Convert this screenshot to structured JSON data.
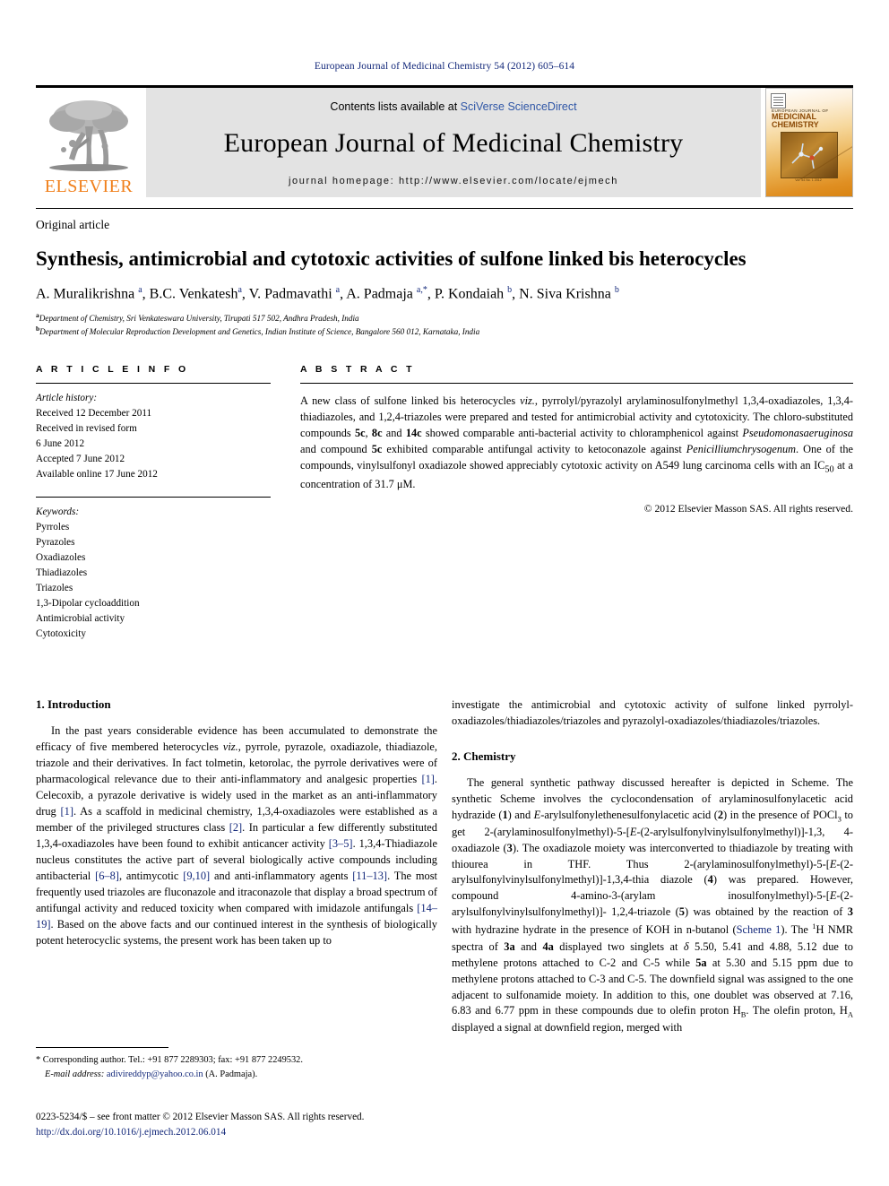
{
  "running_head": "European Journal of Medicinal Chemistry 54 (2012) 605–614",
  "masthead": {
    "contents_prefix": "Contents lists available at ",
    "contents_link": "SciVerse ScienceDirect",
    "journal_title": "European Journal of Medicinal Chemistry",
    "homepage": "journal homepage: http://www.elsevier.com/locate/ejmech",
    "publisher_logo_text": "ELSEVIER",
    "cover": {
      "line1": "EUROPEAN JOURNAL OF",
      "line2": "MEDICINAL CHEMISTRY",
      "caption": "Vol. 54  No. 1  2012"
    }
  },
  "article": {
    "type": "Original article",
    "title": "Synthesis, antimicrobial and cytotoxic activities of sulfone linked bis heterocycles",
    "authors_html": "A. Muralikrishna <sup>a</sup>, B.C. Venkatesh<sup>a</sup>, V. Padmavathi <sup>a</sup>, A. Padmaja <sup>a,*</sup>, P. Kondaiah <sup>b</sup>, N. Siva Krishna <sup>b</sup>",
    "affiliation_a": "Department of Chemistry, Sri Venkateswara University, Tirupati 517 502, Andhra Pradesh, India",
    "affiliation_b": "Department of Molecular Reproduction Development and Genetics, Indian Institute of Science, Bangalore 560 012, Karnataka, India"
  },
  "article_info": {
    "heading": "A R T I C L E   I N F O",
    "history_title": "Article history:",
    "history": [
      "Received 12 December 2011",
      "Received in revised form",
      "6 June 2012",
      "Accepted 7 June 2012",
      "Available online 17 June 2012"
    ],
    "keywords_title": "Keywords:",
    "keywords": [
      "Pyrroles",
      "Pyrazoles",
      "Oxadiazoles",
      "Thiadiazoles",
      "Triazoles",
      "1,3-Dipolar cycloaddition",
      "Antimicrobial activity",
      "Cytotoxicity"
    ]
  },
  "abstract": {
    "heading": "A B S T R A C T",
    "text_html": "A new class of sulfone linked bis heterocycles <i>viz.</i>, pyrrolyl/pyrazolyl arylaminosulfonylmethyl 1,3,4-oxadiazoles, 1,3,4-thiadiazoles, and 1,2,4-triazoles were prepared and tested for antimicrobial activity and cytotoxicity. The chloro-substituted compounds <b>5c</b>, <b>8c</b> and <b>14c</b> showed comparable anti-bacterial activity to chloramphenicol against <i>Pseudomonasaeruginosa</i> and compound <b>5c</b> exhibited comparable antifungal activity to ketoconazole against <i>Penicilliumchrysogenum</i>. One of the compounds, vinylsulfonyl oxadiazole showed appreciably cytotoxic activity on A549 lung carcinoma cells with an IC<sub>50</sub> at a concentration of 31.7 μM.",
    "copyright": "© 2012 Elsevier Masson SAS. All rights reserved."
  },
  "sections": {
    "introduction": {
      "number_title": "1.  Introduction",
      "para_left_html": "In the past years considerable evidence has been accumulated to demonstrate the efficacy of five membered heterocycles <i>viz.</i>, pyrrole, pyrazole, oxadiazole, thiadiazole, triazole and their derivatives. In fact tolmetin, ketorolac, the pyrrole derivatives were of pharmacological relevance due to their anti-inflammatory and analgesic properties <span class=\"ref\">[1]</span>. Celecoxib, a pyrazole derivative is widely used in the market as an anti-inflammatory drug <span class=\"ref\">[1]</span>. As a scaffold in medicinal chemistry, 1,3,4-oxadiazoles were established as a member of the privileged structures class <span class=\"ref\">[2]</span>. In particular a few differently substituted 1,3,4-oxadiazoles have been found to exhibit anticancer activity <span class=\"ref\">[3–5]</span>. 1,3,4-Thiadiazole nucleus constitutes the active part of several biologically active compounds including antibacterial <span class=\"ref\">[6–8]</span>, antimycotic <span class=\"ref\">[9,10]</span> and anti-inflammatory agents <span class=\"ref\">[11–13]</span>. The most frequently used triazoles are fluconazole and itraconazole that display a broad spectrum of antifungal activity and reduced toxicity when compared with imidazole antifungals <span class=\"ref\">[14–19]</span>. Based on the above facts and our continued interest in the synthesis of biologically potent heterocyclic systems, the present work has been taken up to",
      "para_right_html": "investigate the antimicrobial and cytotoxic activity of sulfone linked pyrrolyl-oxadiazoles/thiadiazoles/triazoles and pyrazolyl-oxadiazoles/thiadiazoles/triazoles."
    },
    "chemistry": {
      "number_title": "2.  Chemistry",
      "para_html": "The general synthetic pathway discussed hereafter is depicted in Scheme. The synthetic Scheme involves the cyclocondensation of arylaminosulfonylacetic acid hydrazide (<b>1</b>) and <i>E</i>-arylsulfonylethenesulfonylacetic acid (<b>2</b>) in the presence of POCl<sub>3</sub> to get 2-(arylaminosulfonylmethyl)-5-[<i>E</i>-(2-arylsulfonylvinylsulfonylmethyl)]-1,3, 4-oxadiazole (<b>3</b>). The oxadiazole moiety was interconverted to thiadiazole by treating with thiourea in THF. Thus 2-(arylaminosulfonylmethyl)-5-[<i>E</i>-(2-arylsulfonylvinylsulfonylmethyl)]-1,3,4-thia diazole (<b>4</b>) was prepared. However, compound 4-amino-3-(arylam inosulfonylmethyl)-5-[<i>E</i>-(2-arylsulfonylvinylsulfonylmethyl)]- 1,2,4-triazole (<b>5</b>) was obtained by the reaction of <b>3</b> with hydrazine hydrate in the presence of KOH in n-butanol (<span class=\"ref\">Scheme 1</span>). The <sup>1</sup>H NMR spectra of <b>3a</b> and <b>4a</b> displayed two singlets at <i>δ</i> 5.50, 5.41 and 4.88, 5.12 due to methylene protons attached to C-2 and C-5 while <b>5a</b> at 5.30 and 5.15 ppm due to methylene protons attached to C-3 and C-5. The downfield signal was assigned to the one adjacent to sulfonamide moiety. In addition to this, one doublet was observed at 7.16, 6.83 and 6.77 ppm in these compounds due to olefin proton H<sub>B</sub>. The olefin proton, H<sub>A</sub> displayed a signal at downfield region, merged with"
    }
  },
  "footnote": {
    "corresponding_html": "* Corresponding author. Tel.: +91 877 2289303; fax: +91 877 2249532.",
    "email_label": "E-mail address:",
    "email": "adivireddyp@yahoo.co.in",
    "email_owner": "(A. Padmaja)."
  },
  "front_matter": {
    "line1": "0223-5234/$ – see front matter © 2012 Elsevier Masson SAS. All rights reserved.",
    "doi": "http://dx.doi.org/10.1016/j.ejmech.2012.06.014"
  }
}
